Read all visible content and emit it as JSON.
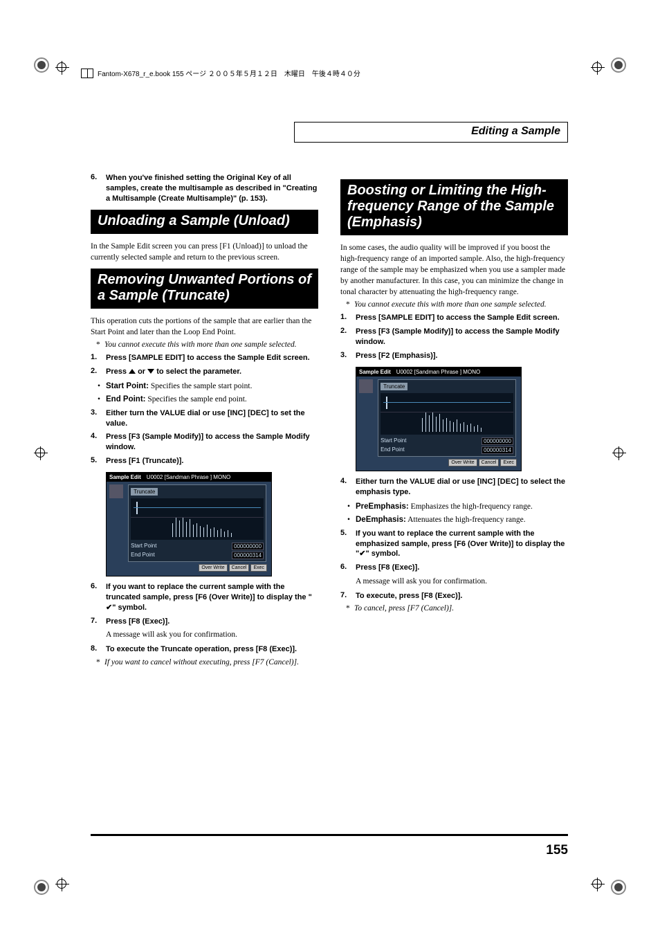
{
  "crop_header": "Fantom-X678_r_e.book 155 ページ ２００５年５月１２日　木曜日　午後４時４０分",
  "page_header": "Editing a Sample",
  "page_number": "155",
  "left": {
    "cont_step6": "When you've finished setting the Original Key of all samples, create the multisample as described in \"Creating a Multisample (Create Multisample)\" (p. 153).",
    "h1": "Unloading a Sample (Unload)",
    "p1": "In the Sample Edit screen you can press [F1 (Unload)] to unload the currently selected sample and return to the previous screen.",
    "h2": "Removing Unwanted Portions of a Sample (Truncate)",
    "p2": "This operation cuts the portions of the sample that are earlier than the Start Point and later than the Loop End Point.",
    "note1": "You cannot execute this with more than one sample selected.",
    "s1": "Press [SAMPLE EDIT] to access the Sample Edit screen.",
    "s2a": "Press ",
    "s2b": " or ",
    "s2c": " to select the parameter.",
    "b1a": "Start Point:",
    "b1b": " Specifies the sample start point.",
    "b2a": "End Point:",
    "b2b": " Specifies the sample end point.",
    "s3": "Either turn the VALUE dial or use [INC] [DEC] to set the value.",
    "s4": "Press [F3 (Sample Modify)] to access the Sample Modify window.",
    "s5": "Press [F1 (Truncate)].",
    "s6a": "If you want to replace the current sample with the truncated sample, press [F6 (Over Write)] to display the \"",
    "s6b": "\" symbol.",
    "s7": "Press [F8 (Exec)].",
    "s7f": "A message will ask you for confirmation.",
    "s8": "To execute the Truncate operation, press [F8 (Exec)].",
    "note2": "If you want to cancel without executing, press [F7 (Cancel)]."
  },
  "right": {
    "h1": "Boosting or Limiting the High-frequency Range of the Sample (Emphasis)",
    "p1": "In some cases, the audio quality will be improved if you boost the high-frequency range of an imported sample. Also, the high-frequency range of the sample may be emphasized when you use a sampler made by another manufacturer. In this case, you can minimize the change in tonal character by attenuating the high-frequency range.",
    "note1": "You cannot execute this with more than one sample selected.",
    "s1": "Press [SAMPLE EDIT] to access the Sample Edit screen.",
    "s2": "Press [F3 (Sample Modify)] to access the Sample Modify window.",
    "s3": "Press [F2 (Emphasis)].",
    "s4": "Either turn the VALUE dial or use [INC] [DEC] to select the emphasis type.",
    "b1a": "PreEmphasis:",
    "b1b": " Emphasizes the high-frequency range.",
    "b2a": "DeEmphasis:",
    "b2b": " Attenuates the high-frequency range.",
    "s5a": "If you want to replace the current sample with the emphasized sample, press [F6 (Over Write)] to display the \"",
    "s5b": "\" symbol.",
    "s6": "Press [F8 (Exec)].",
    "s6f": "A message will ask you for confirmation.",
    "s7": "To execute, press [F8 (Exec)].",
    "note2": "To cancel, press [F7 (Cancel)]."
  },
  "screenshot": {
    "title_a": "Sample Edit",
    "title_b": "U0002 [Sandman Phrase ] MONO",
    "box_label": "Truncate",
    "row1_label": "Start Point",
    "row1_val": "000000000",
    "row2_label": "End Point",
    "row2_val": "000000314",
    "btn1": "Over Write",
    "btn2": "Cancel",
    "btn3": "Exec"
  }
}
